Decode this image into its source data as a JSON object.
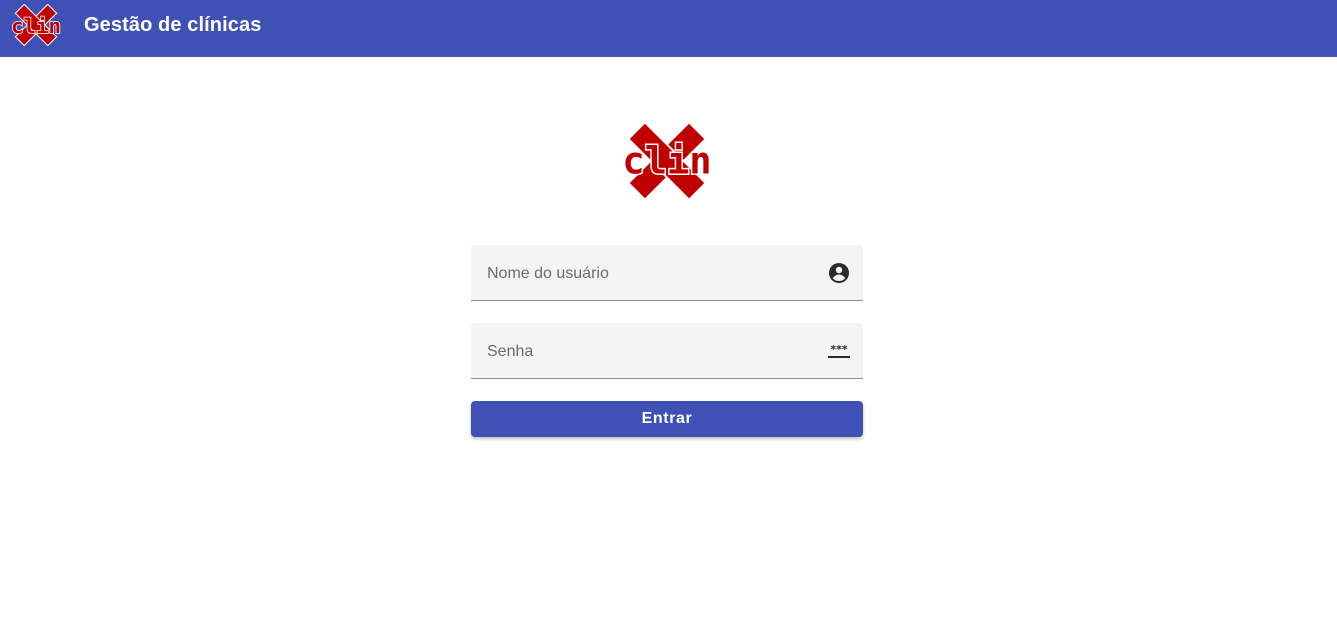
{
  "app": {
    "title": "Gestão de clínicas",
    "logo_text": "clin",
    "brand_color": "#3f51b5",
    "logo_color": "#c00000"
  },
  "login": {
    "username_label": "Nome do usuário",
    "username_icon": "account-circle-icon",
    "password_label": "Senha",
    "password_icon": "password-icon",
    "submit_label": "Entrar"
  }
}
